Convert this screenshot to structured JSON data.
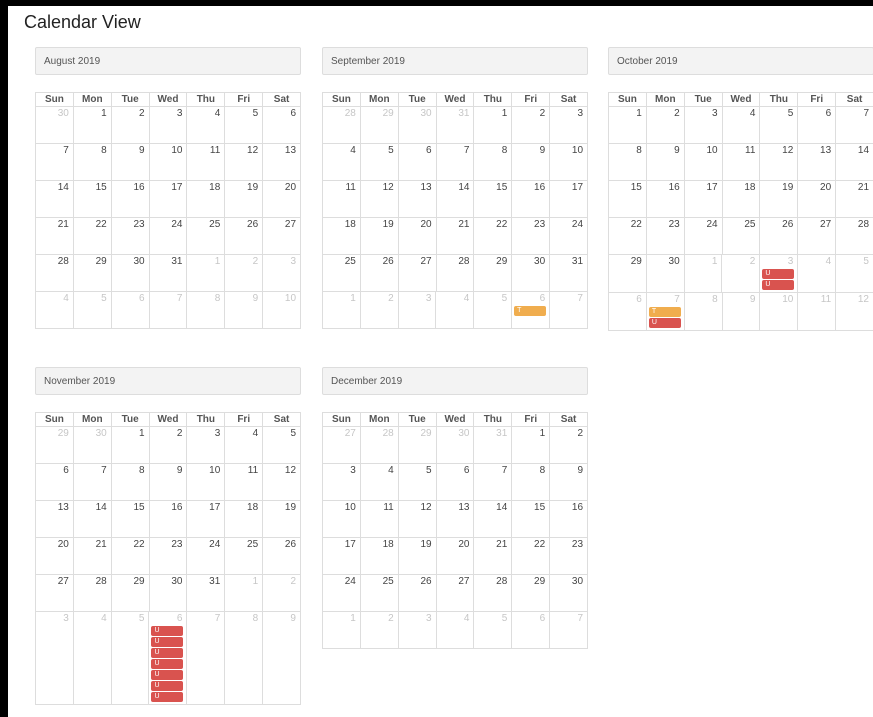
{
  "page": {
    "title": "Calendar View"
  },
  "colors": {
    "T": "#f0ad4e",
    "U": "#d9534f"
  },
  "weekdays": [
    "Sun",
    "Mon",
    "Tue",
    "Wed",
    "Thu",
    "Fri",
    "Sat"
  ],
  "months": [
    {
      "title": "August 2019",
      "weeks": [
        [
          {
            "d": "30",
            "o": true
          },
          {
            "d": "1"
          },
          {
            "d": "2"
          },
          {
            "d": "3"
          },
          {
            "d": "4"
          },
          {
            "d": "5"
          },
          {
            "d": "6"
          }
        ],
        [
          {
            "d": "7"
          },
          {
            "d": "8"
          },
          {
            "d": "9"
          },
          {
            "d": "10"
          },
          {
            "d": "11"
          },
          {
            "d": "12"
          },
          {
            "d": "13"
          }
        ],
        [
          {
            "d": "14"
          },
          {
            "d": "15"
          },
          {
            "d": "16"
          },
          {
            "d": "17"
          },
          {
            "d": "18"
          },
          {
            "d": "19"
          },
          {
            "d": "20"
          }
        ],
        [
          {
            "d": "21"
          },
          {
            "d": "22"
          },
          {
            "d": "23"
          },
          {
            "d": "24"
          },
          {
            "d": "25"
          },
          {
            "d": "26"
          },
          {
            "d": "27"
          }
        ],
        [
          {
            "d": "28"
          },
          {
            "d": "29"
          },
          {
            "d": "30"
          },
          {
            "d": "31"
          },
          {
            "d": "1",
            "o": true
          },
          {
            "d": "2",
            "o": true
          },
          {
            "d": "3",
            "o": true
          }
        ],
        [
          {
            "d": "4",
            "o": true
          },
          {
            "d": "5",
            "o": true
          },
          {
            "d": "6",
            "o": true
          },
          {
            "d": "7",
            "o": true
          },
          {
            "d": "8",
            "o": true
          },
          {
            "d": "9",
            "o": true
          },
          {
            "d": "10",
            "o": true
          }
        ]
      ]
    },
    {
      "title": "September 2019",
      "weeks": [
        [
          {
            "d": "28",
            "o": true
          },
          {
            "d": "29",
            "o": true
          },
          {
            "d": "30",
            "o": true
          },
          {
            "d": "31",
            "o": true
          },
          {
            "d": "1"
          },
          {
            "d": "2"
          },
          {
            "d": "3"
          }
        ],
        [
          {
            "d": "4"
          },
          {
            "d": "5"
          },
          {
            "d": "6"
          },
          {
            "d": "7"
          },
          {
            "d": "8"
          },
          {
            "d": "9"
          },
          {
            "d": "10"
          }
        ],
        [
          {
            "d": "11"
          },
          {
            "d": "12"
          },
          {
            "d": "13"
          },
          {
            "d": "14"
          },
          {
            "d": "15"
          },
          {
            "d": "16"
          },
          {
            "d": "17"
          }
        ],
        [
          {
            "d": "18"
          },
          {
            "d": "19"
          },
          {
            "d": "20"
          },
          {
            "d": "21"
          },
          {
            "d": "22"
          },
          {
            "d": "23"
          },
          {
            "d": "24"
          }
        ],
        [
          {
            "d": "25"
          },
          {
            "d": "26"
          },
          {
            "d": "27"
          },
          {
            "d": "28"
          },
          {
            "d": "29"
          },
          {
            "d": "30"
          },
          {
            "d": "31"
          }
        ],
        [
          {
            "d": "1",
            "o": true
          },
          {
            "d": "2",
            "o": true
          },
          {
            "d": "3",
            "o": true
          },
          {
            "d": "4",
            "o": true
          },
          {
            "d": "5",
            "o": true
          },
          {
            "d": "6",
            "o": true,
            "e": [
              "T"
            ]
          },
          {
            "d": "7",
            "o": true
          }
        ]
      ]
    },
    {
      "title": "October 2019",
      "weeks": [
        [
          {
            "d": "1"
          },
          {
            "d": "2"
          },
          {
            "d": "3"
          },
          {
            "d": "4"
          },
          {
            "d": "5"
          },
          {
            "d": "6"
          },
          {
            "d": "7"
          }
        ],
        [
          {
            "d": "8"
          },
          {
            "d": "9"
          },
          {
            "d": "10"
          },
          {
            "d": "11"
          },
          {
            "d": "12"
          },
          {
            "d": "13"
          },
          {
            "d": "14"
          }
        ],
        [
          {
            "d": "15"
          },
          {
            "d": "16"
          },
          {
            "d": "17"
          },
          {
            "d": "18"
          },
          {
            "d": "19"
          },
          {
            "d": "20"
          },
          {
            "d": "21"
          }
        ],
        [
          {
            "d": "22"
          },
          {
            "d": "23"
          },
          {
            "d": "24"
          },
          {
            "d": "25"
          },
          {
            "d": "26"
          },
          {
            "d": "27"
          },
          {
            "d": "28"
          }
        ],
        [
          {
            "d": "29"
          },
          {
            "d": "30"
          },
          {
            "d": "1",
            "o": true
          },
          {
            "d": "2",
            "o": true
          },
          {
            "d": "3",
            "o": true,
            "e": [
              "U",
              "U"
            ]
          },
          {
            "d": "4",
            "o": true
          },
          {
            "d": "5",
            "o": true
          }
        ],
        [
          {
            "d": "6",
            "o": true
          },
          {
            "d": "7",
            "o": true,
            "e": [
              "T",
              "U"
            ]
          },
          {
            "d": "8",
            "o": true
          },
          {
            "d": "9",
            "o": true
          },
          {
            "d": "10",
            "o": true
          },
          {
            "d": "11",
            "o": true
          },
          {
            "d": "12",
            "o": true
          }
        ]
      ]
    },
    {
      "title": "November 2019",
      "weeks": [
        [
          {
            "d": "29",
            "o": true
          },
          {
            "d": "30",
            "o": true
          },
          {
            "d": "1"
          },
          {
            "d": "2"
          },
          {
            "d": "3"
          },
          {
            "d": "4"
          },
          {
            "d": "5"
          }
        ],
        [
          {
            "d": "6"
          },
          {
            "d": "7"
          },
          {
            "d": "8"
          },
          {
            "d": "9"
          },
          {
            "d": "10"
          },
          {
            "d": "11"
          },
          {
            "d": "12"
          }
        ],
        [
          {
            "d": "13"
          },
          {
            "d": "14"
          },
          {
            "d": "15"
          },
          {
            "d": "16"
          },
          {
            "d": "17"
          },
          {
            "d": "18"
          },
          {
            "d": "19"
          }
        ],
        [
          {
            "d": "20"
          },
          {
            "d": "21"
          },
          {
            "d": "22"
          },
          {
            "d": "23"
          },
          {
            "d": "24"
          },
          {
            "d": "25"
          },
          {
            "d": "26"
          }
        ],
        [
          {
            "d": "27"
          },
          {
            "d": "28"
          },
          {
            "d": "29"
          },
          {
            "d": "30"
          },
          {
            "d": "31"
          },
          {
            "d": "1",
            "o": true
          },
          {
            "d": "2",
            "o": true
          }
        ],
        [
          {
            "d": "3",
            "o": true
          },
          {
            "d": "4",
            "o": true
          },
          {
            "d": "5",
            "o": true
          },
          {
            "d": "6",
            "o": true,
            "e": [
              "U",
              "U",
              "U",
              "U",
              "U",
              "U",
              "U"
            ]
          },
          {
            "d": "7",
            "o": true
          },
          {
            "d": "8",
            "o": true
          },
          {
            "d": "9",
            "o": true
          }
        ]
      ]
    },
    {
      "title": "December 2019",
      "weeks": [
        [
          {
            "d": "27",
            "o": true
          },
          {
            "d": "28",
            "o": true
          },
          {
            "d": "29",
            "o": true
          },
          {
            "d": "30",
            "o": true
          },
          {
            "d": "31",
            "o": true
          },
          {
            "d": "1"
          },
          {
            "d": "2"
          }
        ],
        [
          {
            "d": "3"
          },
          {
            "d": "4"
          },
          {
            "d": "5"
          },
          {
            "d": "6"
          },
          {
            "d": "7"
          },
          {
            "d": "8"
          },
          {
            "d": "9"
          }
        ],
        [
          {
            "d": "10"
          },
          {
            "d": "11"
          },
          {
            "d": "12"
          },
          {
            "d": "13"
          },
          {
            "d": "14"
          },
          {
            "d": "15"
          },
          {
            "d": "16"
          }
        ],
        [
          {
            "d": "17"
          },
          {
            "d": "18"
          },
          {
            "d": "19"
          },
          {
            "d": "20"
          },
          {
            "d": "21"
          },
          {
            "d": "22"
          },
          {
            "d": "23"
          }
        ],
        [
          {
            "d": "24"
          },
          {
            "d": "25"
          },
          {
            "d": "26"
          },
          {
            "d": "27"
          },
          {
            "d": "28"
          },
          {
            "d": "29"
          },
          {
            "d": "30"
          }
        ],
        [
          {
            "d": "1",
            "o": true
          },
          {
            "d": "2",
            "o": true
          },
          {
            "d": "3",
            "o": true
          },
          {
            "d": "4",
            "o": true
          },
          {
            "d": "5",
            "o": true
          },
          {
            "d": "6",
            "o": true
          },
          {
            "d": "7",
            "o": true
          }
        ]
      ]
    }
  ]
}
